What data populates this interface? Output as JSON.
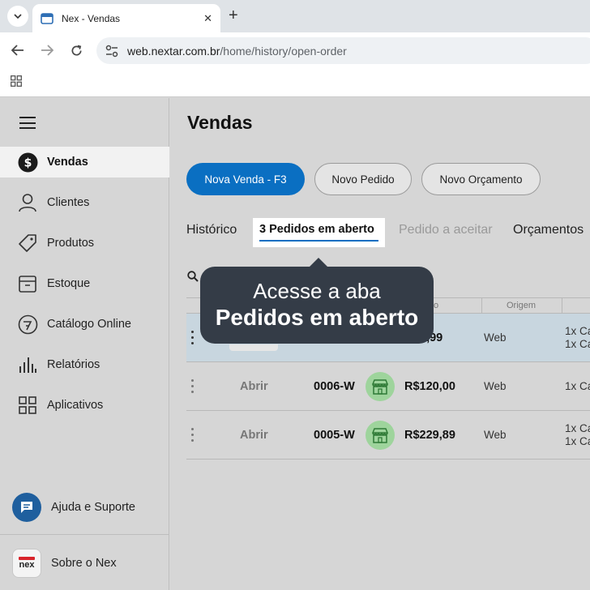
{
  "browser": {
    "tab_title": "Nex - Vendas",
    "close_glyph": "✕",
    "new_tab_glyph": "+",
    "url_domain": "web.nextar.com.br",
    "url_path": "/home/history/open-order"
  },
  "sidebar": {
    "items": [
      {
        "label": "Vendas",
        "icon": "dollar-coin-icon",
        "active": true
      },
      {
        "label": "Clientes",
        "icon": "person-icon"
      },
      {
        "label": "Produtos",
        "icon": "tag-icon"
      },
      {
        "label": "Estoque",
        "icon": "box-icon"
      },
      {
        "label": "Catálogo Online",
        "icon": "catalog-icon"
      },
      {
        "label": "Relatórios",
        "icon": "bar-chart-icon"
      },
      {
        "label": "Aplicativos",
        "icon": "apps-grid-icon"
      }
    ],
    "help_label": "Ajuda e Suporte",
    "about_label": "Sobre o Nex",
    "about_logo_text": "nex"
  },
  "main": {
    "title": "Vendas",
    "buttons": {
      "new_sale": "Nova Venda - F3",
      "new_order": "Novo Pedido",
      "new_quote": "Novo Orçamento"
    },
    "tabs": {
      "history": "Histórico",
      "open_orders": "3 Pedidos em aberto",
      "to_accept": "Pedido a aceitar",
      "quotes": "Orçamentos"
    },
    "table": {
      "headers": {
        "total_partial": "o",
        "origin": "Origem"
      },
      "rows": [
        {
          "action": "",
          "code": "",
          "price": "9,99",
          "origin": "Web",
          "items": [
            "1x Ca",
            "1x Ca"
          ]
        },
        {
          "action": "Abrir",
          "code": "0006-W",
          "price": "R$120,00",
          "origin": "Web",
          "items": [
            "1x Ca"
          ]
        },
        {
          "action": "Abrir",
          "code": "0005-W",
          "price": "R$229,89",
          "origin": "Web",
          "items": [
            "1x Ca",
            "1x Ca"
          ]
        }
      ]
    }
  },
  "tooltip": {
    "line1": "Acesse a aba",
    "line2": "Pedidos em aberto"
  },
  "colors": {
    "primary": "#0a6fc2",
    "tooltip_bg": "#343c47",
    "highlight_row": "#c8d6df",
    "store_badge": "#9ed49c"
  }
}
